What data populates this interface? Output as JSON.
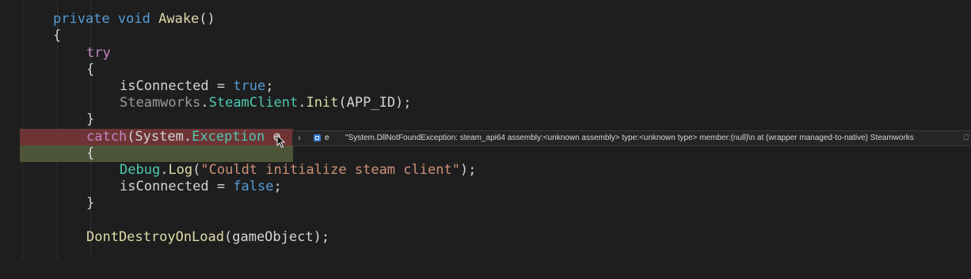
{
  "code": {
    "l1": {
      "kw": "private",
      "kw2": "void",
      "fn": "Awake",
      "rest": "()"
    },
    "l2": "{",
    "l3": "try",
    "l4": "{",
    "l5": {
      "var": "isConnected",
      "op": " = ",
      "val": "true",
      "end": ";"
    },
    "l6": {
      "ns": "Steamworks",
      "dot1": ".",
      "cls": "SteamClient",
      "dot2": ".",
      "fn": "Init",
      "args": "(APP_ID);"
    },
    "l7": "}",
    "l8": {
      "kw": "catch",
      "open": "(System.",
      "type": "Exception",
      "var": " e"
    },
    "l9": "{",
    "l10": {
      "cls": "Debug",
      "dot": ".",
      "fn": "Log",
      "open": "(",
      "str": "\"Couldt initialize steam client\"",
      "close": ");"
    },
    "l11": {
      "var": "isConnected",
      "op": " = ",
      "val": "false",
      "end": ";"
    },
    "l12": "}",
    "l13": {
      "fn": "DontDestroyOnLoad",
      "args": "(gameObject);"
    }
  },
  "tooltip": {
    "expand_icon": "chevron-right-icon",
    "object_icon": "object-icon",
    "var_name": "e",
    "value": "\"System.DllNotFoundException: steam_api64 assembly:<unknown assembly> type:<unknown type> member:(null)\\n  at (wrapper managed-to-native) Steamworks",
    "pin_icon": "pin-icon"
  }
}
